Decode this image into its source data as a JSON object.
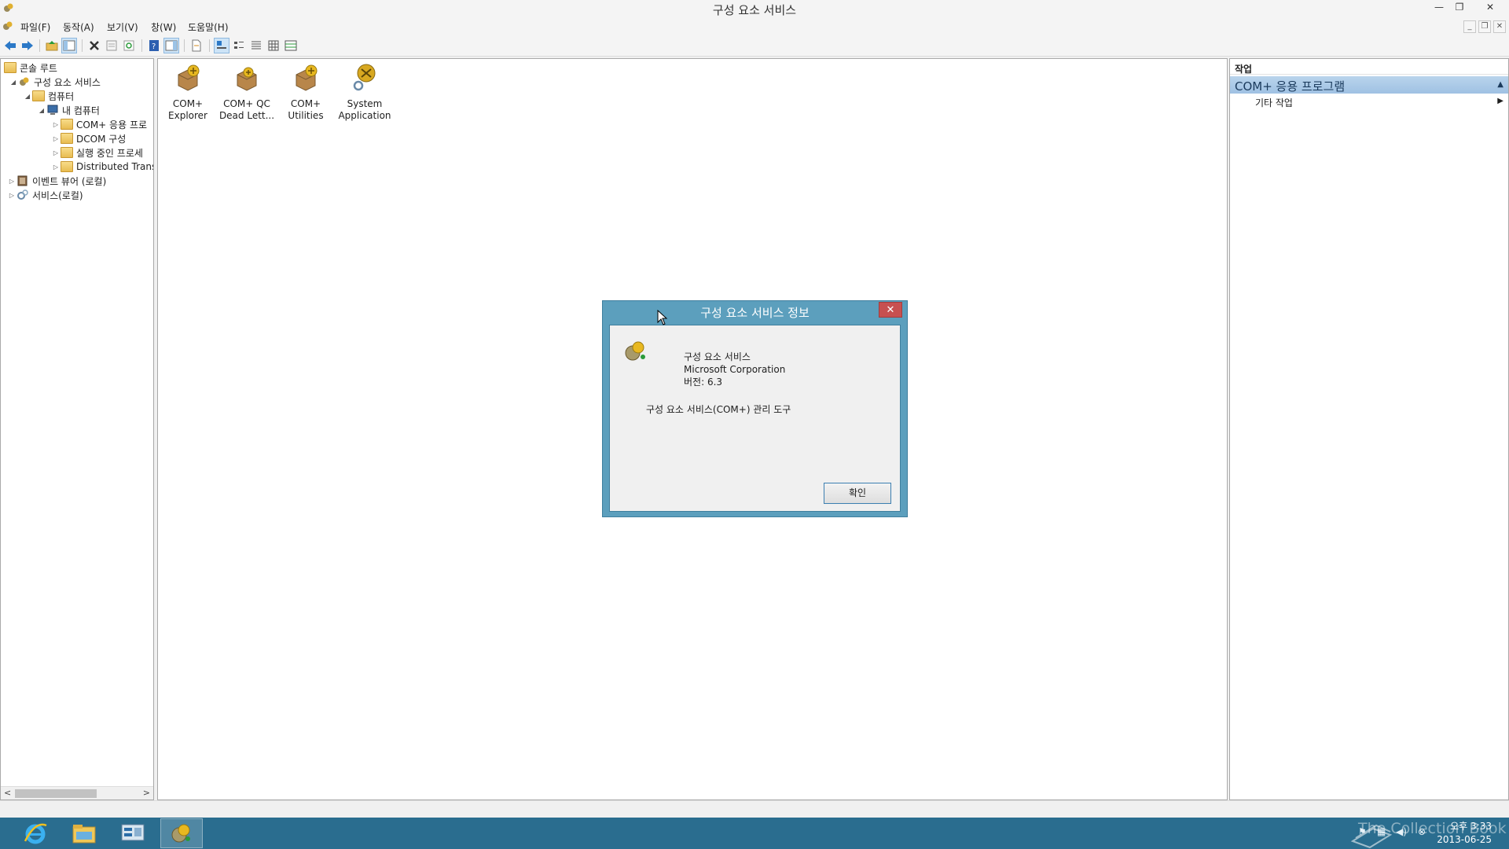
{
  "window": {
    "title": "구성 요소 서비스"
  },
  "menu": {
    "items": [
      "파일(F)",
      "동작(A)",
      "보기(V)",
      "창(W)",
      "도움말(H)"
    ]
  },
  "toolbar": {
    "icons": [
      "back-arrow",
      "forward-arrow",
      "up-folder",
      "show-hide-tree",
      "delete",
      "properties",
      "refresh",
      "help",
      "show-hide-action",
      "export-list",
      "large-icons",
      "small-icons",
      "list",
      "details",
      "custom"
    ]
  },
  "tree": {
    "items": [
      {
        "label": "콘솔 루트",
        "expander": ""
      },
      {
        "label": "구성 요소 서비스",
        "expander": "◢"
      },
      {
        "label": "컴퓨터",
        "expander": "◢"
      },
      {
        "label": "내 컴퓨터",
        "expander": "◢"
      },
      {
        "label": "COM+ 응용 프로",
        "expander": "▷"
      },
      {
        "label": "DCOM 구성",
        "expander": "▷"
      },
      {
        "label": "실행 중인 프로세",
        "expander": "▷"
      },
      {
        "label": "Distributed Trans",
        "expander": "▷"
      },
      {
        "label": "이벤트 뷰어 (로컬)",
        "expander": "▷"
      },
      {
        "label": "서비스(로컬)",
        "expander": "▷"
      }
    ]
  },
  "content": {
    "items": [
      {
        "line1": "COM+",
        "line2": "Explorer"
      },
      {
        "line1": "COM+ QC",
        "line2": "Dead Lett..."
      },
      {
        "line1": "COM+",
        "line2": "Utilities"
      },
      {
        "line1": "System",
        "line2": "Application"
      }
    ]
  },
  "actions": {
    "header": "작업",
    "section": "COM+ 응용 프로그램",
    "item": "기타 작업"
  },
  "dialog": {
    "title": "구성 요소 서비스 정보",
    "close": "✕",
    "product": "구성 요소 서비스",
    "company": "Microsoft Corporation",
    "version": "버전: 6.3",
    "description": "구성 요소 서비스(COM+) 관리 도구",
    "ok": "확인"
  },
  "taskbar": {
    "time": "오후 3:33",
    "date": "2013-06-25",
    "watermark": "The Collection Book"
  },
  "colors": {
    "dialog_frame": "#5c9fbd",
    "taskbar": "#2a6d8f",
    "close_button": "#c75050",
    "selection": "#b9d4ec"
  }
}
